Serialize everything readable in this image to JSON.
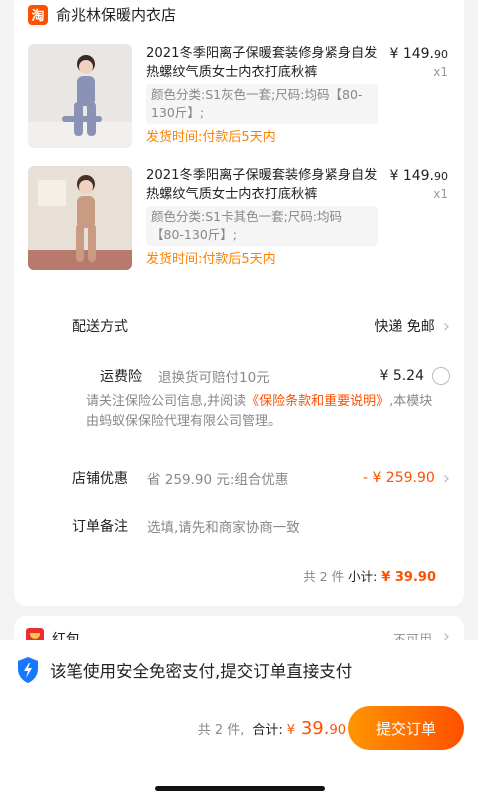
{
  "shop": {
    "logo_text": "淘",
    "name": "俞兆林保暖内衣店"
  },
  "items": [
    {
      "title": "2021冬季阳离子保暖套装修身紧身自发热螺纹气质女士内衣打底秋裤",
      "price": "¥ 149.",
      "price_cents": "90",
      "qty": "x1",
      "sku": "颜色分类:S1灰色一套;尺码:均码【80-130斤】;",
      "ship": "发货时间:付款后5天内",
      "thumb_color": "#8a93b5"
    },
    {
      "title": "2021冬季阳离子保暖套装修身紧身自发热螺纹气质女士内衣打底秋裤",
      "price": "¥ 149.",
      "price_cents": "90",
      "qty": "x1",
      "sku": "颜色分类:S1卡其色一套;尺码:均码【80-130斤】;",
      "ship": "发货时间:付款后5天内",
      "thumb_color": "#c99b83"
    }
  ],
  "delivery": {
    "label": "配送方式",
    "value": "快递 免邮"
  },
  "insurance": {
    "label": "运费险",
    "desc": "退换货可赔付10元",
    "price": "¥ 5.24"
  },
  "notice": {
    "prefix": "请关注保险公司信息,并阅读",
    "link": "《保险条款和重要说明》",
    "suffix": ",本模块由蚂蚁保保险代理有限公司管理。"
  },
  "shop_discount": {
    "label": "店铺优惠",
    "desc": "省 259.90 元:组合优惠",
    "value": "- ¥ 259.90"
  },
  "order_note": {
    "label": "订单备注",
    "placeholder": "选填,请先和商家协商一致"
  },
  "subtotal": {
    "count": "共 2 件",
    "label": "小计:",
    "amount": "¥ 39.90"
  },
  "red_packet": {
    "label": "红包",
    "status": "不可用"
  },
  "secure": {
    "text": "该笔使用安全免密支付,提交订单直接支付"
  },
  "footer": {
    "count": "共 2 件,",
    "label": "合计:",
    "currency": "¥",
    "amount": "39.",
    "amount_cents": "90",
    "submit": "提交订单"
  },
  "colors": {
    "accent": "#ff5000",
    "ship": "#ff8000",
    "shield": "#1677ff"
  },
  "icons": [
    "taobao-logo-icon",
    "chevron-right-icon",
    "radio-icon",
    "red-packet-icon",
    "shield-icon"
  ]
}
